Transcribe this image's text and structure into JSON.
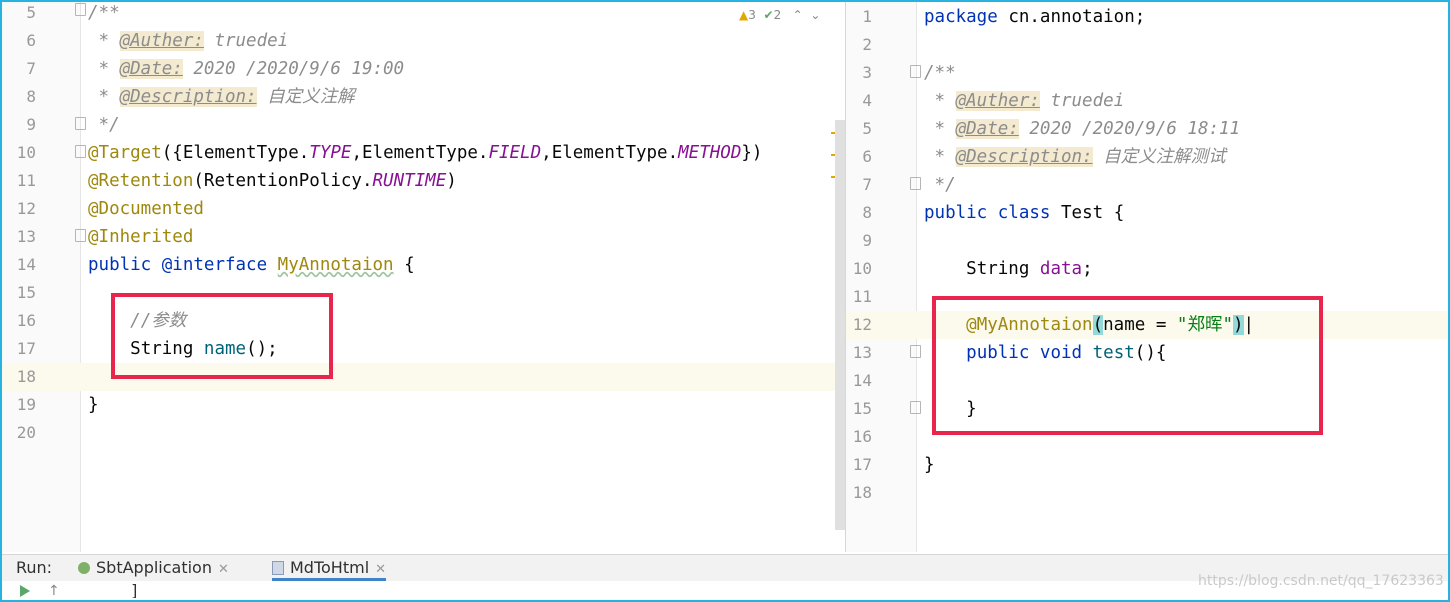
{
  "left_editor": {
    "inspections": {
      "warnings": "3",
      "ok": "2"
    },
    "lines": [
      {
        "n": "5"
      },
      {
        "n": "6"
      },
      {
        "n": "7"
      },
      {
        "n": "8"
      },
      {
        "n": "9"
      },
      {
        "n": "10"
      },
      {
        "n": "11"
      },
      {
        "n": "12"
      },
      {
        "n": "13"
      },
      {
        "n": "14"
      },
      {
        "n": "15"
      },
      {
        "n": "16"
      },
      {
        "n": "17"
      },
      {
        "n": "18"
      },
      {
        "n": "19"
      },
      {
        "n": "20"
      }
    ],
    "text": {
      "doc_open": "/**",
      "auther_tag": "@Auther:",
      "auther_val": "truedei",
      "date_tag": "@Date:",
      "date_val": "2020 /2020/9/6 19:00",
      "desc_tag": "@Description:",
      "desc_val": "自定义注解",
      "doc_close": "*/",
      "target": "@Target",
      "element_type": "ElementType",
      "type_const": "TYPE",
      "field_const": "FIELD",
      "method_const": "METHOD",
      "retention": "@Retention",
      "retention_policy": "RetentionPolicy",
      "runtime": "RUNTIME",
      "documented": "@Documented",
      "inherited": "@Inherited",
      "public_kw": "public",
      "interface_kw": "@interface",
      "annotation_name": "MyAnnotaion",
      "comment_param": "//参数",
      "string_type": "String",
      "method_name": "name"
    }
  },
  "right_editor": {
    "lines": [
      {
        "n": "1"
      },
      {
        "n": "2"
      },
      {
        "n": "3"
      },
      {
        "n": "4"
      },
      {
        "n": "5"
      },
      {
        "n": "6"
      },
      {
        "n": "7"
      },
      {
        "n": "8"
      },
      {
        "n": "9"
      },
      {
        "n": "10"
      },
      {
        "n": "11"
      },
      {
        "n": "12"
      },
      {
        "n": "13"
      },
      {
        "n": "14"
      },
      {
        "n": "15"
      },
      {
        "n": "16"
      },
      {
        "n": "17"
      },
      {
        "n": "18"
      }
    ],
    "text": {
      "package_kw": "package",
      "package_name": "cn.annotaion;",
      "doc_open": "/**",
      "auther_tag": "@Auther:",
      "auther_val": "truedei",
      "date_tag": "@Date:",
      "date_val": "2020 /2020/9/6 18:11",
      "desc_tag": "@Description:",
      "desc_val": "自定义注解测试",
      "doc_close": "*/",
      "public_kw": "public",
      "class_kw": "class",
      "class_name": "Test",
      "string_type": "String",
      "field_name": "data",
      "annotation_usage": "@MyAnnotaion",
      "param_name": "name",
      "param_value": "\"郑晖\"",
      "void_kw": "void",
      "method_name": "test"
    }
  },
  "run_bar": {
    "label": "Run:",
    "tabs": [
      {
        "label": "SbtApplication",
        "active": false
      },
      {
        "label": "MdToHtml",
        "active": true
      }
    ]
  },
  "console": {
    "text": "]"
  },
  "watermark": "https://blog.csdn.net/qq_17623363",
  "colors": {
    "highlight_box": "#e8264d",
    "frame": "#27b3e0",
    "keyword": "#0033b3",
    "annotation": "#9e880d",
    "constant": "#871094"
  }
}
